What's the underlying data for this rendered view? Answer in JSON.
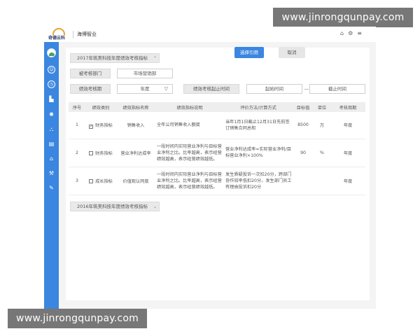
{
  "watermark": {
    "text": "www.jinrongqunpay.com"
  },
  "header": {
    "logo_text": "奇德云科",
    "company": "海博智业",
    "icons": [
      "home-icon",
      "gear-icon",
      "menu-icon"
    ]
  },
  "sidebar": {
    "accent_color": "#3b86e0",
    "icons": [
      "user-icon",
      "clock-icon",
      "building-icon",
      "globe-icon",
      "org-chart-icon",
      "books-icon",
      "bank-icon",
      "tools-icon",
      "edit-icon"
    ]
  },
  "sections": {
    "current": "2017年筑美科技年度绩效考核指标",
    "previous": "2016年筑美科技年度绩效考核指标"
  },
  "actions": {
    "select": "选择引用",
    "cancel": "取消"
  },
  "form": {
    "dept_label": "被考核部门",
    "dept_value": "市场营销部",
    "period_label": "绩效考核期",
    "period_value": "年度",
    "range_label": "绩效考核起止时间",
    "start_placeholder": "起始时间",
    "separator": "—",
    "end_placeholder": "截止时间"
  },
  "table": {
    "headers": [
      "序号",
      "绩效类别",
      "绩效指标名称",
      "绩效指标说明",
      "评价方法/计算方式",
      "目标值",
      "单位",
      "考核周期"
    ],
    "rows": [
      {
        "no": "1",
        "checked": "✓",
        "category": "财务指标",
        "name": "销售收入",
        "desc": "全年公司销售收入额度",
        "method": "当年1月1日截止12月31日先前签订销售合同总和",
        "target": "8500",
        "unit": "万",
        "cycle": "年度"
      },
      {
        "no": "2",
        "checked": "",
        "category": "财务指标",
        "name": "营业净利达成率",
        "desc": "一段时间内实际营业净利与目标营业净利之比。比率越高，表示经营绩效越高，表示经营绩效越低。",
        "method": "营业净利达成率=实际营业净利/目标营业净利×100%",
        "target": "90",
        "unit": "%",
        "cycle": "年度"
      },
      {
        "no": "3",
        "checked": "",
        "category": "成长指标",
        "name": "价值观认同度",
        "desc": "一段时间内实际营业净利与目标营业净利之比。比率越高，表示经营绩效越高，表示经营绩效越低。",
        "method": "发生质疑投诉一次扣20分，跨部门协作效率低扣20分，发生部门员工有理由投诉扣20分",
        "target": "",
        "unit": "",
        "cycle": "年度"
      }
    ]
  }
}
